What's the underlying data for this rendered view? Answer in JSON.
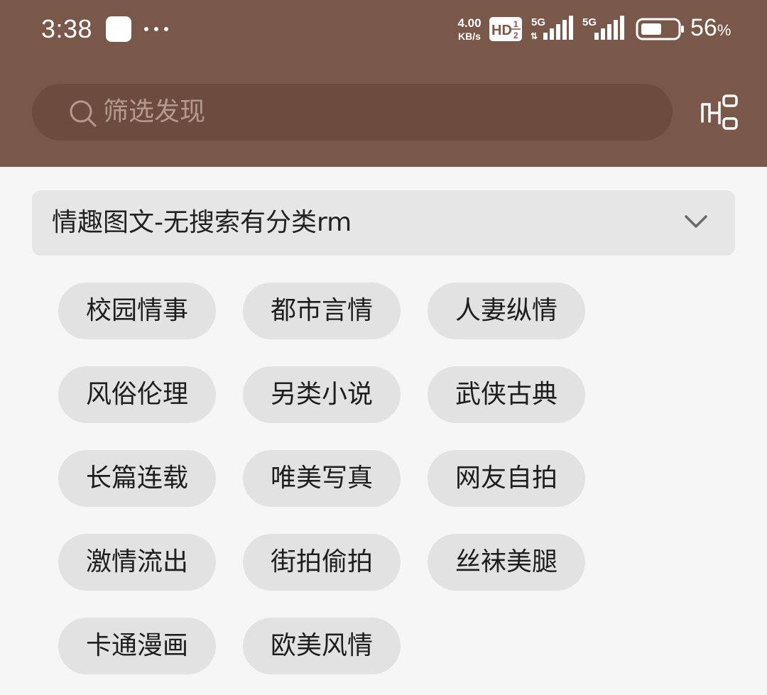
{
  "status_bar": {
    "time": "3:38",
    "net_speed_value": "4.00",
    "net_speed_unit": "KB/s",
    "hd_badge": "HD",
    "signal_1_label": "5G",
    "signal_2_label": "5G",
    "battery_value": "56",
    "battery_unit": "%"
  },
  "search": {
    "placeholder": "筛选发现",
    "icon": "search-icon"
  },
  "header": {
    "background_color": "#7a5849",
    "right_icon": "layout-icon"
  },
  "dropdown": {
    "selected": "情趣图文-无搜索有分类rm",
    "icon": "chevron-down-icon"
  },
  "categories": [
    "校园情事",
    "都市言情",
    "人妻纵情",
    "风俗伦理",
    "另类小说",
    "武侠古典",
    "长篇连载",
    "唯美写真",
    "网友自拍",
    "激情流出",
    "街拍偷拍",
    "丝袜美腿",
    "卡通漫画",
    "欧美风情"
  ]
}
